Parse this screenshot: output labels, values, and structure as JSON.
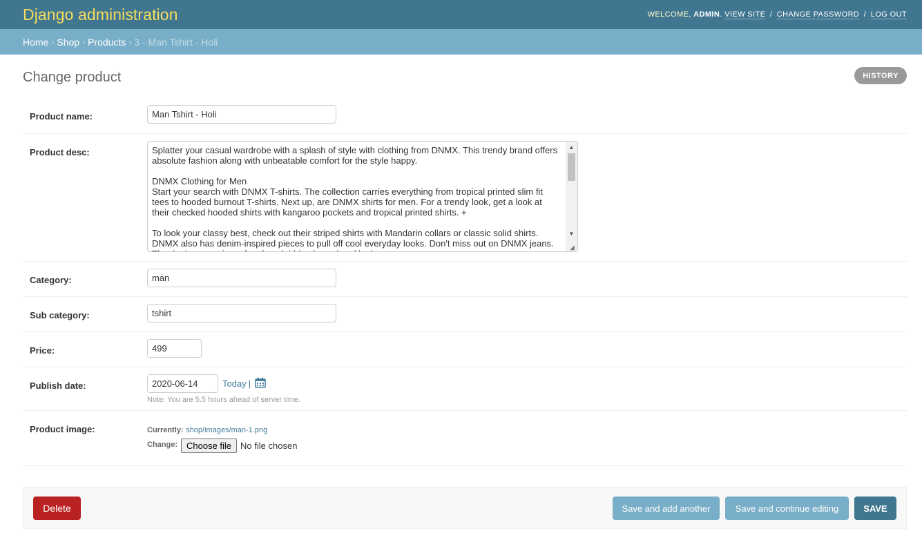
{
  "header": {
    "branding": "Django administration",
    "welcome_prefix": "WELCOME, ",
    "username": "ADMIN",
    "welcome_suffix": ".",
    "view_site": "VIEW SITE",
    "change_password": "CHANGE PASSWORD",
    "log_out": "LOG OUT",
    "separator": "/"
  },
  "breadcrumbs": {
    "home": "Home",
    "shop": "Shop",
    "products": "Products",
    "current": "3 - Man Tshirt - Holi",
    "arrow": "›"
  },
  "page": {
    "title": "Change product",
    "history_button": "HISTORY"
  },
  "form": {
    "product_name": {
      "label": "Product name:",
      "value": "Man Tshirt - Holi"
    },
    "product_desc": {
      "label": "Product desc:",
      "value": "Splatter your casual wardrobe with a splash of style with clothing from DNMX. This trendy brand offers absolute fashion along with unbeatable comfort for the style happy.\n\nDNMX Clothing for Men\nStart your search with DNMX T-shirts. The collection carries everything from tropical printed slim fit tees to hooded burnout T-shirts. Next up, are DNMX shirts for men. For a trendy look, get a look at their checked hooded shirts with kangaroo pockets and tropical printed shirts. +\n\nTo look your classy best, check out their striped shirts with Mandarin collars or classic solid shirts. DNMX also has denim-inspired pieces to pull off cool everyday looks. Don't miss out on DNMX jeans. The denim range is perfect for a laid-back weekend look."
    },
    "category": {
      "label": "Category:",
      "value": "man"
    },
    "sub_category": {
      "label": "Sub category:",
      "value": "tshirt"
    },
    "price": {
      "label": "Price:",
      "value": "499"
    },
    "publish_date": {
      "label": "Publish date:",
      "value": "2020-06-14",
      "today_link": "Today",
      "separator": "|",
      "help": "Note: You are 5.5 hours ahead of server time."
    },
    "product_image": {
      "label": "Product image:",
      "currently_label": "Currently:",
      "currently_value": "shop/images/man-1.png",
      "change_label": "Change:",
      "choose_button": "Choose file",
      "no_file": "No file chosen"
    }
  },
  "submit_row": {
    "delete": "Delete",
    "save_add_another": "Save and add another",
    "save_continue": "Save and continue editing",
    "save": "SAVE"
  },
  "colors": {
    "header_bg": "#417690",
    "branding": "#f5dd5d",
    "breadcrumbs_bg": "#79aec8",
    "delete_bg": "#ba2121",
    "secondary_button_bg": "#79aec8",
    "primary_button_bg": "#417690",
    "link": "#447e9b"
  },
  "icons": {
    "calendar": "calendar-icon",
    "scroll_up": "scroll-up-arrow-icon",
    "scroll_down": "scroll-down-arrow-icon",
    "resize": "resize-grip-icon"
  }
}
